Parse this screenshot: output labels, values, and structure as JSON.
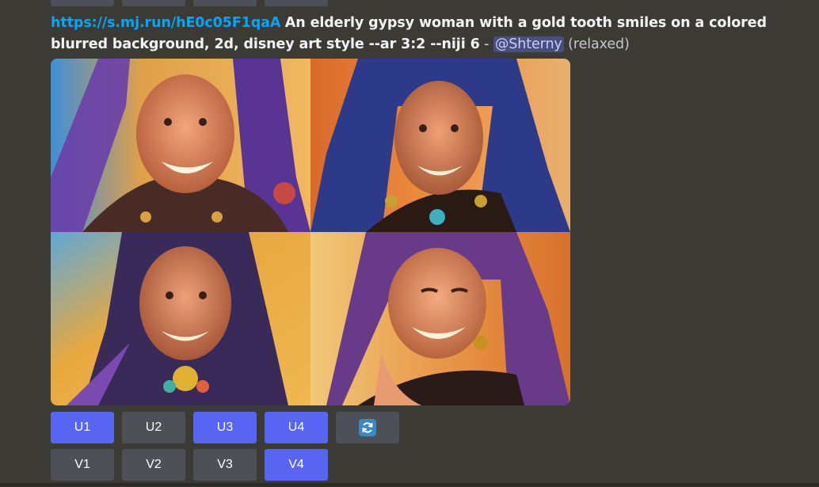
{
  "message": {
    "link": "https://s.mj.run/hE0c05F1qaA",
    "prompt": "An elderly gypsy woman with a gold tooth smiles on a colored blurred background, 2d, disney art style --ar 3:2 --niji 6",
    "separator": "-",
    "mention": "@Shterny",
    "mode": "(relaxed)"
  },
  "upscale_buttons": [
    {
      "label": "U1",
      "state": "primary"
    },
    {
      "label": "U2",
      "state": "secondary"
    },
    {
      "label": "U3",
      "state": "primary"
    },
    {
      "label": "U4",
      "state": "primary"
    }
  ],
  "reroll_button": {
    "icon": "refresh-icon"
  },
  "variation_buttons": [
    {
      "label": "V1",
      "state": "secondary"
    },
    {
      "label": "V2",
      "state": "secondary"
    },
    {
      "label": "V3",
      "state": "secondary"
    },
    {
      "label": "V4",
      "state": "primary"
    }
  ],
  "colors": {
    "background": "#3c3a35",
    "primary_button": "#5865f2",
    "secondary_button": "#4e5058",
    "link": "#00a8fc"
  }
}
